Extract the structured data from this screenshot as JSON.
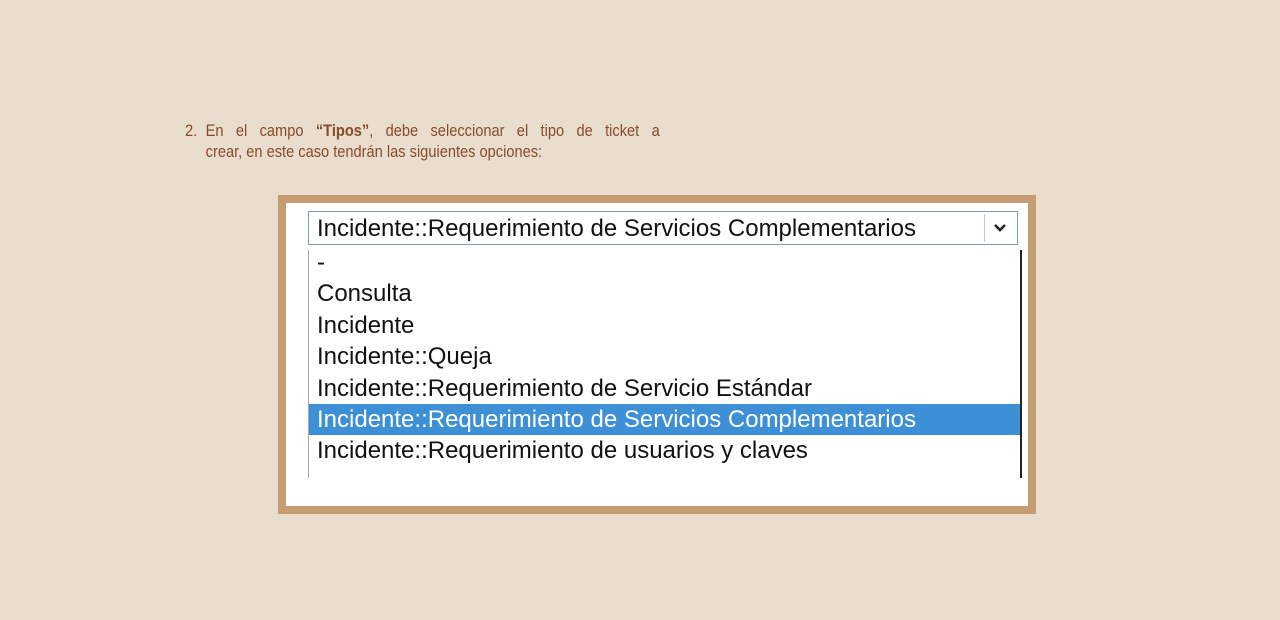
{
  "instruction": {
    "number": "2.",
    "line1_before": "En el campo ",
    "line1_field": "“Tipos”",
    "line1_after": ", debe seleccionar el tipo de ticket a",
    "line2": "crear, en este caso tendrán las siguientes opciones:"
  },
  "select": {
    "value": "Incidente::Requerimiento de Servicios Complementarios",
    "arrow_icon": "chevron-down-icon"
  },
  "options": [
    {
      "label": "-",
      "selected": false
    },
    {
      "label": "Consulta",
      "selected": false
    },
    {
      "label": "Incidente",
      "selected": false
    },
    {
      "label": "Incidente::Queja",
      "selected": false
    },
    {
      "label": "Incidente::Requerimiento de Servicio Estándar",
      "selected": false
    },
    {
      "label": "Incidente::Requerimiento de Servicios Complementarios",
      "selected": true
    },
    {
      "label": "Incidente::Requerimiento de usuarios y claves",
      "selected": false
    }
  ],
  "colors": {
    "background": "#e9dece",
    "instruction_text": "#8a4a2a",
    "frame": "#c69c72",
    "highlight": "#3d8fd6"
  }
}
